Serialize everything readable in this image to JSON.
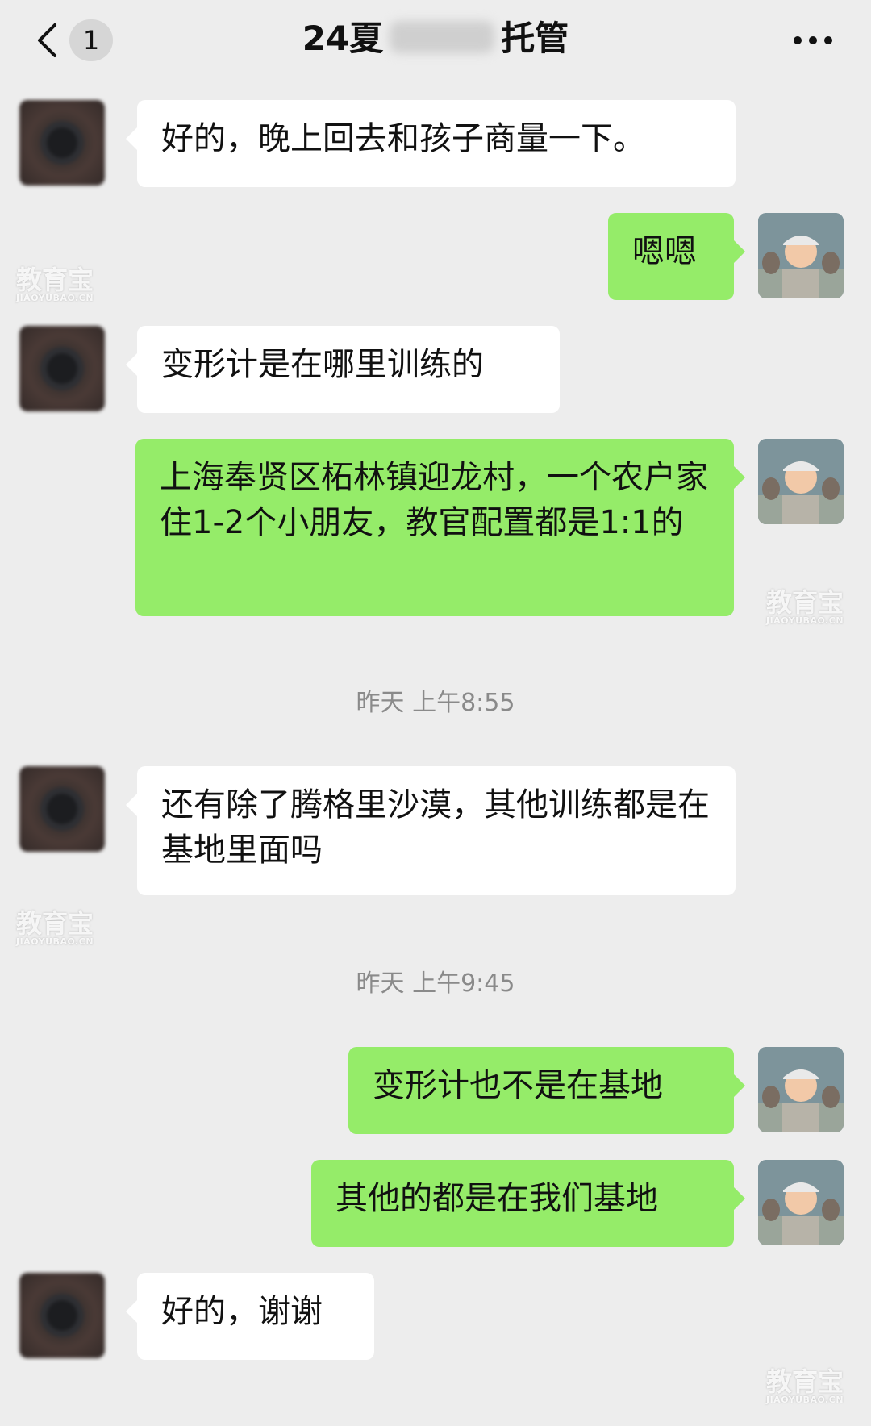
{
  "header": {
    "back_icon": "chevron-left-icon",
    "unread_count": "1",
    "title_prefix": "24夏",
    "title_suffix": "托管",
    "more_icon": "more-dots-icon"
  },
  "messages": [
    {
      "side": "left",
      "text": "好的，晚上回去和孩子商量一下。"
    },
    {
      "side": "right",
      "text": "嗯嗯"
    },
    {
      "side": "left",
      "text": "变形计是在哪里训练的"
    },
    {
      "side": "right",
      "text": "上海奉贤区柘林镇迎龙村，一个农户家住1-2个小朋友，教官配置都是1:1的"
    },
    {
      "side": "left",
      "text": "还有除了腾格里沙漠，其他训练都是在基地里面吗"
    },
    {
      "side": "right",
      "text": "变形计也不是在基地"
    },
    {
      "side": "right",
      "text": "其他的都是在我们基地"
    },
    {
      "side": "left",
      "text": "好的，谢谢"
    }
  ],
  "timestamps": [
    "昨天 上午8:55",
    "昨天 上午9:45"
  ],
  "watermark": {
    "big": "教育宝",
    "small": "JIAOYUBAO.CN"
  },
  "colors": {
    "background": "#ededed",
    "my_bubble": "#95ec69",
    "their_bubble": "#ffffff"
  }
}
